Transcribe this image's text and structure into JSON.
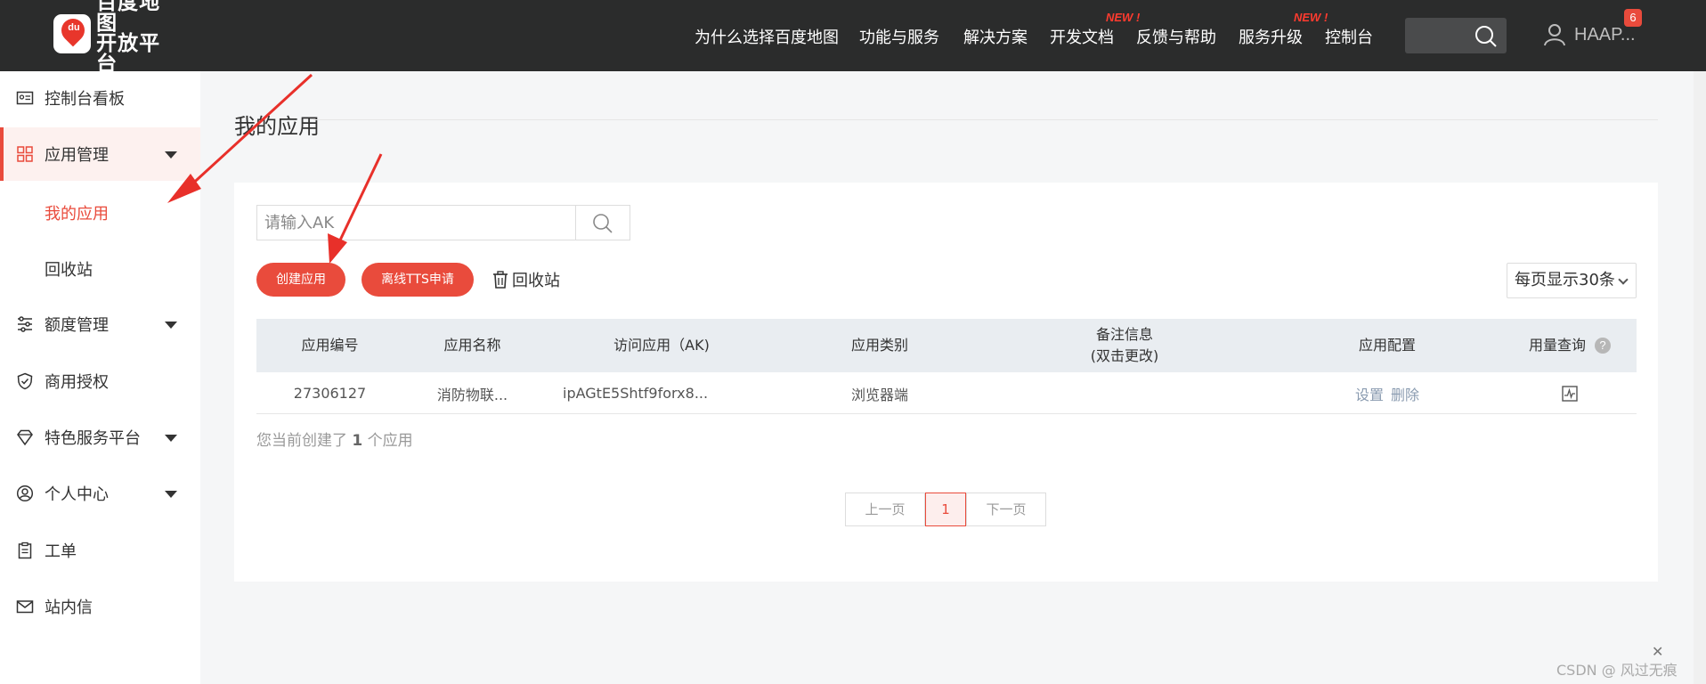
{
  "header": {
    "logo_line1": "百度地图",
    "logo_line2": "开放平台",
    "logo_badge": "du",
    "nav": [
      {
        "label": "为什么选择百度地图",
        "new": ""
      },
      {
        "label": "功能与服务",
        "new": ""
      },
      {
        "label": "解决方案",
        "new": ""
      },
      {
        "label": "开发文档",
        "new": "NEW !"
      },
      {
        "label": "反馈与帮助",
        "new": ""
      },
      {
        "label": "服务升级",
        "new": "NEW !"
      },
      {
        "label": "控制台",
        "new": ""
      }
    ],
    "user_name": "HAAP...",
    "notification_count": "6"
  },
  "sidebar": {
    "items": [
      {
        "label": "控制台看板",
        "icon": "dashboard-card-icon"
      },
      {
        "label": "应用管理",
        "icon": "grid-apps-icon"
      },
      {
        "label": "额度管理",
        "icon": "sliders-icon"
      },
      {
        "label": "商用授权",
        "icon": "shield-check-icon"
      },
      {
        "label": "特色服务平台",
        "icon": "diamond-icon"
      },
      {
        "label": "个人中心",
        "icon": "user-circle-icon"
      },
      {
        "label": "工单",
        "icon": "clipboard-icon"
      },
      {
        "label": "站内信",
        "icon": "mail-icon"
      }
    ],
    "sub_items": [
      {
        "label": "我的应用",
        "active": true
      },
      {
        "label": "回收站",
        "active": false
      }
    ]
  },
  "main": {
    "title": "我的应用",
    "search_placeholder": "请输入AK",
    "create_button": "创建应用",
    "tts_button": "离线TTS申请",
    "recycle_label": "回收站",
    "per_page": "每页显示30条",
    "columns": [
      "应用编号",
      "应用名称",
      "访问应用（AK)",
      "应用类别",
      "备注信息",
      "(双击更改)",
      "应用配置",
      "用量查询"
    ],
    "rows": [
      {
        "id": "27306127",
        "name": "消防物联...",
        "ak": "ipAGtE5Shtf9forx8...",
        "category": "浏览器端",
        "note": "",
        "config_set": "设置",
        "config_delete": "删除"
      }
    ],
    "summary_prefix": "您当前创建了",
    "summary_count": "1",
    "summary_suffix": "个应用",
    "pagination": {
      "prev": "上一页",
      "current": "1",
      "next": "下一页"
    }
  },
  "watermark": "CSDN @ 风过无痕",
  "colors": {
    "accent": "#e94b3c",
    "topbar": "#2b2c2c",
    "arrow": "#e8302a"
  }
}
